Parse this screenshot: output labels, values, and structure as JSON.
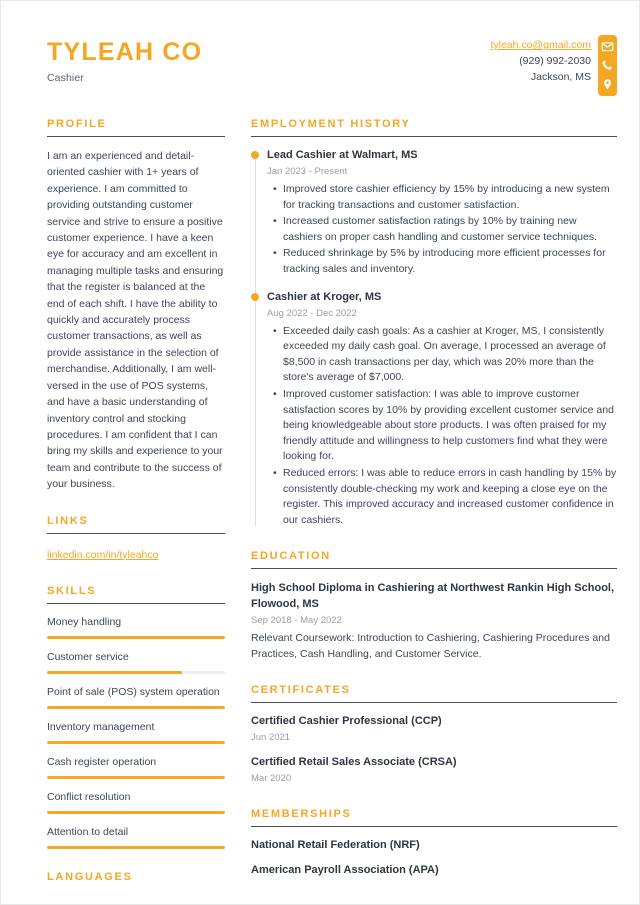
{
  "header": {
    "full_name": "TYLEAH CO",
    "job_title": "Cashier",
    "contact": {
      "email": "tyleah.co@gmail.com",
      "phone": "(929) 992-2030",
      "location": "Jackson, MS"
    },
    "icons": [
      "envelope-icon",
      "phone-icon",
      "location-pin-icon"
    ]
  },
  "theme": {
    "accent": "#F5A623",
    "text": "#3e4654",
    "heading": "#2f3640",
    "muted": "#9aa0a8",
    "rule": "#4a4f58",
    "track": "#eceef0"
  },
  "sidebar": {
    "profile": {
      "heading": "PROFILE",
      "text": "I am an experienced and detail-oriented cashier with 1+ years of experience. I am committed to providing outstanding customer service and strive to ensure a positive customer experience. I have a keen eye for accuracy and am excellent in managing multiple tasks and ensuring that the register is balanced at the end of each shift. I have the ability to quickly and accurately process customer transactions, as well as provide assistance in the selection of merchandise. Additionally, I am well-versed in the use of POS systems, and have a basic understanding of inventory control and stocking procedures. I am confident that I can bring my skills and experience to your team and contribute to the success of your business."
    },
    "links": {
      "heading": "LINKS",
      "items": [
        {
          "label": "linkedin.com/in/tyleahco"
        }
      ]
    },
    "skills": {
      "heading": "SKILLS",
      "items": [
        {
          "label": "Money handling",
          "level": 100
        },
        {
          "label": "Customer service",
          "level": 76
        },
        {
          "label": "Point of sale (POS) system operation",
          "level": 100
        },
        {
          "label": "Inventory management",
          "level": 100
        },
        {
          "label": "Cash register operation",
          "level": 100
        },
        {
          "label": "Conflict resolution",
          "level": 100
        },
        {
          "label": "Attention to detail",
          "level": 100
        }
      ]
    },
    "languages": {
      "heading": "LANGUAGES"
    }
  },
  "main": {
    "employment": {
      "heading": "EMPLOYMENT HISTORY",
      "jobs": [
        {
          "title": "Lead Cashier at Walmart, MS",
          "date": "Jan 2023 - Present",
          "bullets": [
            "Improved store cashier efficiency by 15% by introducing a new system for tracking transactions and customer satisfaction.",
            "Increased customer satisfaction ratings by 10% by training new cashiers on proper cash handling and customer service techniques.",
            "Reduced shrinkage by 5% by introducing more efficient processes for tracking sales and inventory."
          ]
        },
        {
          "title": "Cashier at Kroger, MS",
          "date": "Aug 2022 - Dec 2022",
          "bullets": [
            "Exceeded daily cash goals: As a cashier at Kroger, MS, I consistently exceeded my daily cash goal. On average, I processed an average of $8,500 in cash transactions per day, which was 20% more than the store's average of $7,000.",
            "Improved customer satisfaction: I was able to improve customer satisfaction scores by 10% by providing excellent customer service and being knowledgeable about store products. I was often praised for my friendly attitude and willingness to help customers find what they were looking for.",
            "Reduced errors: I was able to reduce errors in cash handling by 15% by consistently double-checking my work and keeping a close eye on the register. This improved accuracy and increased customer confidence in our cashiers."
          ]
        }
      ]
    },
    "education": {
      "heading": "EDUCATION",
      "entries": [
        {
          "title": "High School Diploma in Cashiering at Northwest Rankin High School, Flowood, MS",
          "date": "Sep 2018 - May 2022",
          "description": "Relevant Coursework: Introduction to Cashiering, Cashiering Procedures and Practices, Cash Handling, and Customer Service."
        }
      ]
    },
    "certificates": {
      "heading": "CERTIFICATES",
      "entries": [
        {
          "title": "Certified Cashier Professional (CCP)",
          "date": "Jun 2021"
        },
        {
          "title": "Certified Retail Sales Associate (CRSA)",
          "date": "Mar 2020"
        }
      ]
    },
    "memberships": {
      "heading": "MEMBERSHIPS",
      "entries": [
        {
          "title": "National Retail Federation (NRF)"
        },
        {
          "title": "American Payroll Association (APA)"
        }
      ]
    }
  }
}
